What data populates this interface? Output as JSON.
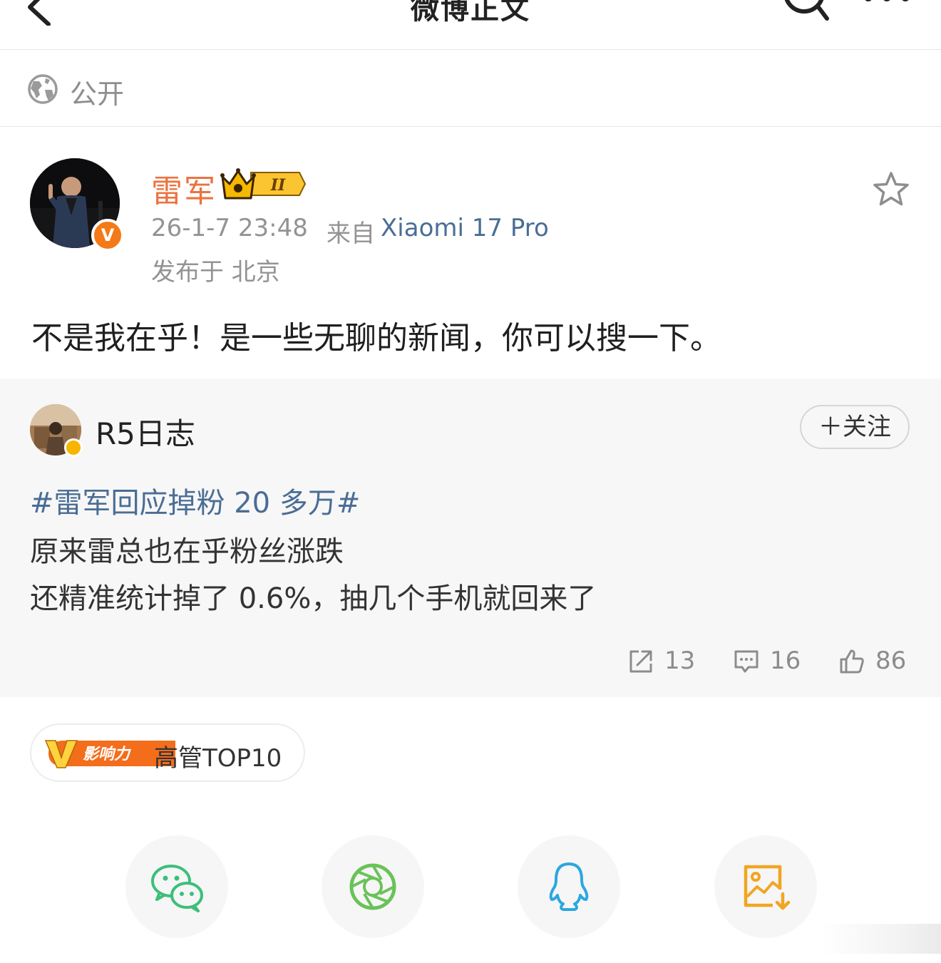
{
  "nav": {
    "title": "微博正文"
  },
  "visibility": {
    "label": "公开"
  },
  "author": {
    "name": "雷军",
    "level_badge": "II",
    "time": "26-1-7 23:48",
    "from_label": "来自",
    "device": "Xiaomi 17 Pro",
    "location": "发布于 北京"
  },
  "post": {
    "text": "不是我在乎！是一些无聊的新闻，你可以搜一下。"
  },
  "repost": {
    "author": "R5日志",
    "follow_label": "＋关注",
    "hashtag": "#雷军回应掉粉 20 多万#",
    "lines": [
      "原来雷总也在乎粉丝涨跌",
      "还精准统计掉了 0.6%，抽几个手机就回来了"
    ],
    "stats": {
      "reposts": "13",
      "comments": "16",
      "likes": "86"
    }
  },
  "influence": {
    "badge": "影响力",
    "text": "高管TOP10"
  },
  "colors": {
    "author_name": "#eb7340",
    "link": "#4a6d95",
    "verified_badge": "#f37a16",
    "card_background": "#f7f7f7"
  },
  "share": {
    "icons": [
      "wechat-icon",
      "moments-icon",
      "qq-icon",
      "save-image-icon"
    ]
  }
}
